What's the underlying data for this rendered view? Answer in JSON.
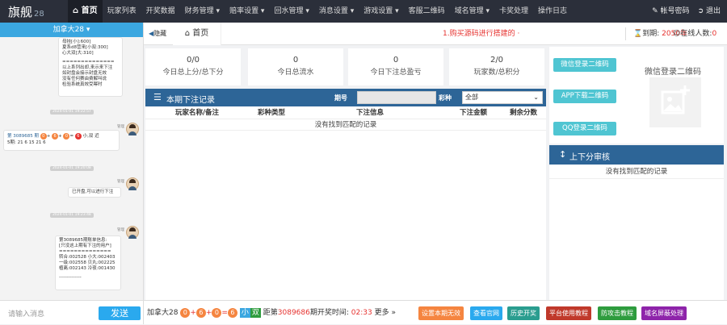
{
  "app": {
    "logo": "旗舰",
    "logo_sub": "28"
  },
  "nav": [
    "首页",
    "玩家列表",
    "开奖数据",
    "财务管理 ▾",
    "赔率设置 ▾",
    "回水管理 ▾",
    "消息设置 ▾",
    "游戏设置 ▾",
    "客服二维码",
    "域名管理 ▾",
    "卡奖处理",
    "操作日志"
  ],
  "topright": {
    "account": "帐号密码",
    "logout": "退出"
  },
  "chat": {
    "header": "加拿大28 ▾",
    "input_placeholder": "请输入消息",
    "send": "发送",
    "msg1": [
      "母挂[小]:600]",
      "夏系d8营来[小双:300]",
      "心大双[大:310]",
      "",
      "==============",
      "以上系列出却,来示来下注",
      "如封盘会接示封盘无效",
      "没有任何赛由费解叫说",
      "检验系统真效受幂时"
    ],
    "time2": "2024-01-01 19:22:57",
    "sender": "管理",
    "msg2_line1": "第 3089685 期",
    "msg2_balls": [
      "0",
      "6",
      "0",
      "6"
    ],
    "msg2_tail": "小,双 近",
    "msg2_line2": "5期: 21 6 15 21 6",
    "time3": "2024-01-01 19:20:08",
    "msg3": "已开盘,可以进行下注",
    "time4": "2024-01-01 19:23:48",
    "msg4": [
      "第3089685期账单信息:",
      "[只没这上期有下注的用户]",
      "==============",
      "转合:002528 小大:002403",
      "一级:002558 贝丸:002225",
      "植离:002143 冷夜:001430",
      "",
      "--------------"
    ]
  },
  "tabbar": {
    "hide": "隐藏",
    "home": "首页",
    "notice": "1.购买源码进行搭建的 ·",
    "expire_label": "到期:",
    "expire_year": "2050年",
    "online_label": "在线人数:",
    "online_count": "0"
  },
  "stats": [
    {
      "value": "0/0",
      "label": "今日总上分/总下分"
    },
    {
      "value": "0",
      "label": "今日总流水"
    },
    {
      "value": "0",
      "label": "今日下注总盈亏"
    },
    {
      "value": "2/0",
      "label": "玩家数/总积分"
    }
  ],
  "bets": {
    "title": "本期下注记录",
    "issue_label": "期号",
    "type_label": "彩种",
    "type_value": "全部",
    "columns": [
      "玩家名称/备注",
      "彩种类型",
      "下注信息",
      "下注金额",
      "剩余分数"
    ],
    "empty": "没有找到匹配的记录"
  },
  "qr": {
    "buttons": [
      "微信登录二维码",
      "APP下载二维码",
      "QQ登录二维码"
    ],
    "title": "微信登录二维码"
  },
  "audit": {
    "title": "上下分审核",
    "empty": "没有找到匹配的记录"
  },
  "bottom": {
    "game": "加拿大28",
    "balls": [
      "0",
      "6",
      "0",
      "6"
    ],
    "tag_small": "小",
    "tag_even": "双",
    "distance": "距第",
    "issue": "3089686",
    "open_text": "期开奖时间:",
    "countdown": "02:33",
    "more": "更多 »",
    "buttons": [
      "设置本期无效",
      "查看官网",
      "历史开奖",
      "平台使用教程",
      "防攻击教程",
      "域名屏蔽处理"
    ]
  },
  "colors": {
    "topbar": "#2b2f3a",
    "accent": "#3ba7e0",
    "panel_head": "#2d6597",
    "qr_btn": "#4fc5d2",
    "red": "#e6322f",
    "orange": "#f58540"
  }
}
